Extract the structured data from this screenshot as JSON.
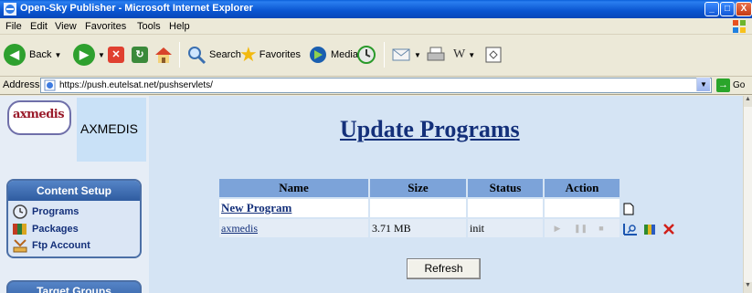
{
  "window": {
    "title": "Open-Sky Publisher - Microsoft Internet Explorer",
    "minimize_glyph": "_",
    "maximize_glyph": "□",
    "close_glyph": "X"
  },
  "menu": [
    "File",
    "Edit",
    "View",
    "Favorites",
    "Tools",
    "Help"
  ],
  "toolbar": {
    "back_label": "Back",
    "search_label": "Search",
    "favorites_label": "Favorites",
    "media_label": "Media"
  },
  "address": {
    "label": "Address",
    "url": "https://push.eutelsat.net/pushservlets/",
    "go_label": "Go"
  },
  "sidebar": {
    "logo_text": "axmedis",
    "brand_name": "AXMEDIS",
    "content_setup_title": "Content Setup",
    "items": [
      {
        "label": "Programs",
        "icon": "clock-icon"
      },
      {
        "label": "Packages",
        "icon": "packages-icon"
      },
      {
        "label": "Ftp Account",
        "icon": "ftp-account-icon"
      }
    ],
    "target_groups_title": "Target Groups"
  },
  "main": {
    "title": "Update Programs",
    "columns": [
      "Name",
      "Size",
      "Status",
      "Action"
    ],
    "new_program_label": "New Program",
    "rows": [
      {
        "name": "axmedis",
        "size": "3.71 MB",
        "status": "init"
      }
    ],
    "refresh_label": "Refresh"
  },
  "colors": {
    "title_bar": "#0a55d0",
    "page_background": "#d5e4f4",
    "table_header": "#7ca3d9",
    "link": "#14307a",
    "delete_icon": "#d0201a"
  }
}
